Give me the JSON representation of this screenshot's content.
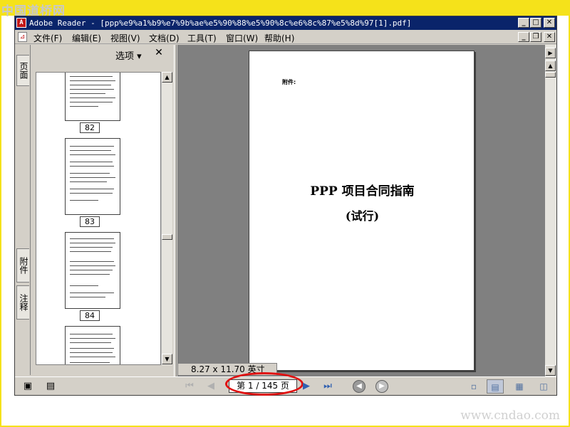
{
  "watermarks": {
    "top": "中国道桥网",
    "bottom": "www.cndao.com"
  },
  "window": {
    "title": "Adobe Reader - [ppp%e9%a1%b9%e7%9b%ae%e5%90%88%e5%90%8c%e6%8c%87%e5%8d%97[1].pdf]",
    "controls": {
      "minimize": "_",
      "maximize": "□",
      "close": "✕",
      "restore": "❐"
    }
  },
  "menu": {
    "items": [
      "文件(F)",
      "编辑(E)",
      "视图(V)",
      "文档(D)",
      "工具(T)",
      "窗口(W)",
      "帮助(H)"
    ]
  },
  "side_tabs": {
    "pages": "页面",
    "attachments": "附件",
    "comments": "注释"
  },
  "panel": {
    "options_label": "选项 ▾",
    "close_label": "✕",
    "thumbnails": [
      {
        "label": "82"
      },
      {
        "label": "83"
      },
      {
        "label": "84"
      },
      {
        "label": ""
      }
    ]
  },
  "document": {
    "attachment_label": "附件:",
    "title": "PPP 项目合同指南",
    "subtitle": "(试行)",
    "page_size": "8.27 x 11.70 英寸"
  },
  "navigation": {
    "page_display": "第 1 / 145 页",
    "icons": {
      "first_page": "first-page-icon",
      "prev_page": "previous-page-icon",
      "next_page": "next-page-icon",
      "last_page": "last-page-icon"
    }
  },
  "colors": {
    "title_bar": "#0a246a",
    "frame": "#f5e21a",
    "highlight_ellipse": "#e01010",
    "doc_background": "#808080"
  }
}
